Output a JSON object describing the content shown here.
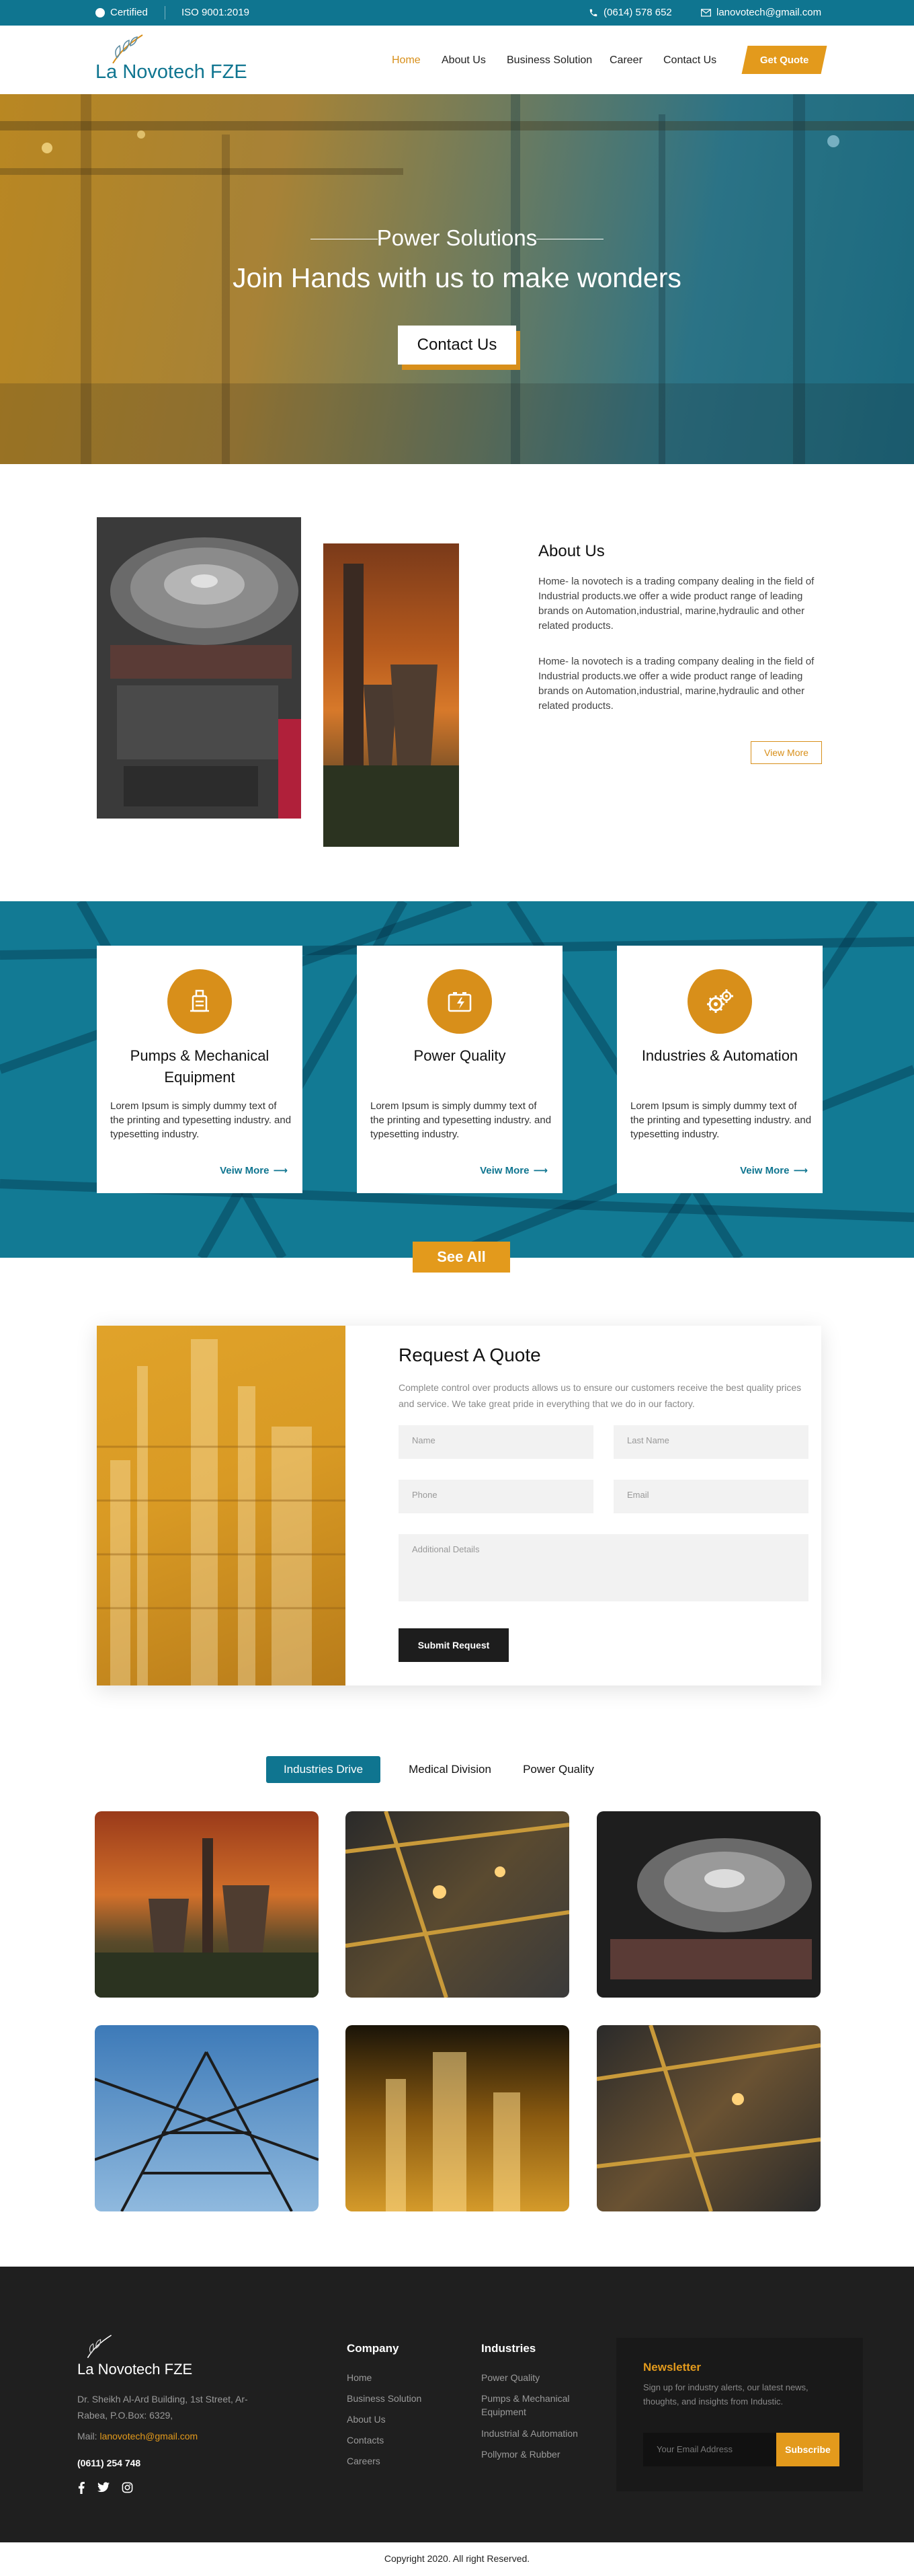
{
  "topbar": {
    "certified": "Certified",
    "iso": "ISO 9001:2019",
    "phone": "(0614) 578 652",
    "email": "lanovotech@gmail.com"
  },
  "header": {
    "logo_text": "La Novotech FZE",
    "nav": [
      "Home",
      "About Us",
      "Business Solution",
      "Career",
      "Contact Us"
    ],
    "active": "Home",
    "quote_button": "Get Quote"
  },
  "hero": {
    "tag": "Power Solutions",
    "title": "Join Hands with us to make wonders",
    "cta": "Contact Us"
  },
  "about": {
    "title": "About Us",
    "paragraphs": [
      "Home- la novotech is a trading company dealing in the field of Industrial products.we offer a wide product range of leading brands on Automation,industrial, marine,hydraulic and other related products.",
      "Home- la novotech is a trading company dealing in the field of Industrial products.we offer a wide product range of leading brands on Automation,industrial, marine,hydraulic and other related products."
    ],
    "view_more": "View More"
  },
  "services": {
    "cards": [
      {
        "title": "Pumps & Mechanical Equipment",
        "text": "Lorem Ipsum is simply dummy text of the printing and typesetting industry. and typesetting industry.",
        "link": "Veiw More",
        "icon": "pump-icon"
      },
      {
        "title": "Power Quality",
        "text": "Lorem Ipsum is simply dummy text of the printing and typesetting industry. and typesetting industry.",
        "link": "Veiw More",
        "icon": "battery-icon"
      },
      {
        "title": "Industries & Automation",
        "text": "Lorem Ipsum is simply dummy text of the printing and typesetting industry. and typesetting industry.",
        "link": "Veiw More",
        "icon": "gears-icon"
      }
    ],
    "see_all": "See All"
  },
  "request_quote": {
    "title": "Request A Quote",
    "description": "Complete control over products allows us to ensure our customers receive the best quality prices and service. We take great pride in everything that we do in our factory.",
    "fields": {
      "name": "Name",
      "last_name": "Last Name",
      "phone": "Phone",
      "email": "Email",
      "details": "Additional Details"
    },
    "submit": "Submit Request"
  },
  "gallery": {
    "tabs": [
      "Industries Drive",
      "Medical Division",
      "Power Quality"
    ],
    "active_tab": "Industries Drive"
  },
  "footer": {
    "logo_text": "La Novotech FZE",
    "address": "Dr. Sheikh Al-Ard Building, 1st Street, Ar-Rabea, P.O.Box: 6329,",
    "mail_label": "Mail:",
    "mail": "lanovotech@gmail.com",
    "phone": "(0611) 254 748",
    "company_title": "Company",
    "company_links": [
      "Home",
      "Business Solution",
      "About Us",
      "Contacts",
      "Careers"
    ],
    "industries_title": "Industries",
    "industries_links": [
      "Power Quality",
      "Pumps & Mechanical Equipment",
      "Industrial & Automation",
      "Pollymor & Rubber"
    ],
    "newsletter_title": "Newsletter",
    "newsletter_text": "Sign up for industry alerts, our latest news, thoughts, and insights from Industic.",
    "newsletter_placeholder": "Your Email Address",
    "subscribe": "Subscribe",
    "copyright": "Copyright 2020. All right Reserved."
  },
  "colors": {
    "brand_teal": "#0f7590",
    "accent_orange": "#e39a1c",
    "footer_bg": "#1f1f1f"
  }
}
